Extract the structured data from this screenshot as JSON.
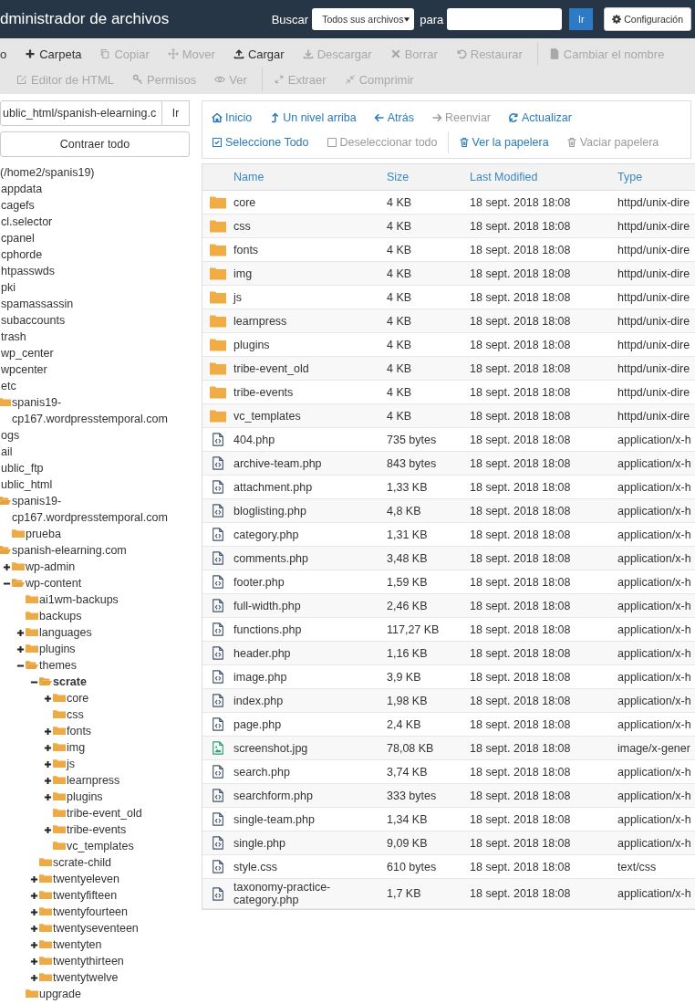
{
  "header": {
    "title": "dministrador de archivos",
    "search_label": "Buscar",
    "search_scope": "Todos sus archivos",
    "for_label": "para",
    "go_button": "Ir",
    "settings_button": "Configuración"
  },
  "toolbar": {
    "lines": [
      {
        "groups": [
          {
            "buttons": [
              {
                "label": "o",
                "disabled": false
              },
              {
                "label": "Carpeta",
                "disabled": false
              },
              {
                "label": "Copiar",
                "disabled": true
              },
              {
                "label": "Mover",
                "disabled": true
              },
              {
                "label": "Cargar",
                "disabled": false
              },
              {
                "label": "Descargar",
                "disabled": true
              },
              {
                "label": "Borrar",
                "disabled": true
              },
              {
                "label": "Restaurar",
                "disabled": true
              }
            ]
          },
          {
            "buttons": [
              {
                "label": "Cambiar el nombre",
                "disabled": true
              }
            ]
          }
        ]
      },
      {
        "groups": [
          {
            "buttons": [
              {
                "label": "Editor de HTML",
                "disabled": true
              },
              {
                "label": "Permisos",
                "disabled": true
              },
              {
                "label": "Ver",
                "disabled": true
              }
            ]
          },
          {
            "buttons": [
              {
                "label": "Extraer",
                "disabled": true
              },
              {
                "label": "Comprimir",
                "disabled": true
              }
            ]
          }
        ]
      }
    ]
  },
  "sidebar": {
    "path": "ublic_html/spanish-elearning.c",
    "path_button": "Ir",
    "collapse_button": "Contraer todo",
    "root": "(/home2/spanis19)",
    "tree": [
      {
        "label": "appdata",
        "selected": false
      },
      {
        "label": "cagefs",
        "selected": false
      },
      {
        "label": "cl.selector",
        "selected": false
      },
      {
        "label": "cpanel",
        "selected": false
      },
      {
        "label": "cphorde",
        "selected": false
      },
      {
        "label": "htpasswds",
        "selected": false
      },
      {
        "label": "pki",
        "selected": false
      },
      {
        "label": "spamassassin",
        "selected": false
      },
      {
        "label": "subaccounts",
        "selected": false
      },
      {
        "label": "trash",
        "selected": false
      },
      {
        "label": "wp_center",
        "selected": false
      },
      {
        "label": "wpcenter",
        "selected": false
      },
      {
        "label": "etc",
        "selected": false,
        "children": [
          {
            "label": "spanis19-cp167.wordpresstemporal.com",
            "selected": false
          }
        ]
      },
      {
        "label": "ogs",
        "selected": false
      },
      {
        "label": "ail",
        "selected": false
      },
      {
        "label": "ublic_ftp",
        "selected": false
      },
      {
        "label": "ublic_html",
        "selected": false,
        "children": [
          {
            "label": "spanis19-cp167.wordpresstemporal.com",
            "selected": false,
            "expanded": true,
            "children": [
              {
                "label": "prueba",
                "selected": false
              }
            ]
          },
          {
            "label": "spanish-elearning.com",
            "selected": false,
            "expanded": true,
            "children": [
              {
                "label": "wp-admin",
                "selected": false,
                "expanded": false
              },
              {
                "label": "wp-content",
                "selected": false,
                "expanded": true,
                "children": [
                  {
                    "label": "ai1wm-backups",
                    "selected": false
                  },
                  {
                    "label": "backups",
                    "selected": false
                  },
                  {
                    "label": "languages",
                    "selected": false,
                    "expanded": false
                  },
                  {
                    "label": "plugins",
                    "selected": false,
                    "expanded": false
                  },
                  {
                    "label": "themes",
                    "selected": false,
                    "expanded": true,
                    "children": [
                      {
                        "label": "scrate",
                        "selected": true,
                        "expanded": true,
                        "children": [
                          {
                            "label": "core",
                            "selected": false,
                            "expanded": false
                          },
                          {
                            "label": "css",
                            "selected": false
                          },
                          {
                            "label": "fonts",
                            "selected": false,
                            "expanded": false
                          },
                          {
                            "label": "img",
                            "selected": false,
                            "expanded": false
                          },
                          {
                            "label": "js",
                            "selected": false,
                            "expanded": false
                          },
                          {
                            "label": "learnpress",
                            "selected": false,
                            "expanded": false
                          },
                          {
                            "label": "plugins",
                            "selected": false,
                            "expanded": false
                          },
                          {
                            "label": "tribe-event_old",
                            "selected": false
                          },
                          {
                            "label": "tribe-events",
                            "selected": false,
                            "expanded": false
                          },
                          {
                            "label": "vc_templates",
                            "selected": false
                          }
                        ]
                      },
                      {
                        "label": "scrate-child",
                        "selected": false
                      },
                      {
                        "label": "twentyeleven",
                        "selected": false,
                        "expanded": false
                      },
                      {
                        "label": "twentyfifteen",
                        "selected": false,
                        "expanded": false
                      },
                      {
                        "label": "twentyfourteen",
                        "selected": false,
                        "expanded": false
                      },
                      {
                        "label": "twentyseventeen",
                        "selected": false,
                        "expanded": false
                      },
                      {
                        "label": "twentyten",
                        "selected": false,
                        "expanded": false
                      },
                      {
                        "label": "twentythirteen",
                        "selected": false,
                        "expanded": false
                      },
                      {
                        "label": "twentytwelve",
                        "selected": false,
                        "expanded": false
                      }
                    ]
                  },
                  {
                    "label": "upgrade",
                    "selected": false
                  }
                ]
              }
            ]
          }
        ]
      }
    ]
  },
  "nav": {
    "lines": [
      {
        "buttons": [
          {
            "label": "Inicio",
            "disabled": false
          },
          {
            "label": "Un nivel arriba",
            "disabled": false
          },
          {
            "label": "Atrás",
            "disabled": false
          },
          {
            "label": "Reenviar",
            "disabled": true
          },
          {
            "label": "Actualizar",
            "disabled": false
          }
        ]
      },
      {
        "buttons": [
          {
            "label": "Seleccione Todo",
            "disabled": false
          },
          {
            "label": "Deseleccionar todo",
            "disabled": true
          },
          {
            "label": "Ver la papelera",
            "disabled": false
          },
          {
            "label": "Vaciar papelera",
            "disabled": true
          }
        ]
      }
    ]
  },
  "table": {
    "columns": [
      "Name",
      "Size",
      "Last Modified",
      "Type"
    ],
    "rows": [
      {
        "kind": "folder",
        "name": "core",
        "size": "4 KB",
        "modified": "18 sept. 2018 18:08",
        "type": "httpd/unix-dire"
      },
      {
        "kind": "folder",
        "name": "css",
        "size": "4 KB",
        "modified": "18 sept. 2018 18:08",
        "type": "httpd/unix-dire"
      },
      {
        "kind": "folder",
        "name": "fonts",
        "size": "4 KB",
        "modified": "18 sept. 2018 18:08",
        "type": "httpd/unix-dire"
      },
      {
        "kind": "folder",
        "name": "img",
        "size": "4 KB",
        "modified": "18 sept. 2018 18:08",
        "type": "httpd/unix-dire"
      },
      {
        "kind": "folder",
        "name": "js",
        "size": "4 KB",
        "modified": "18 sept. 2018 18:08",
        "type": "httpd/unix-dire"
      },
      {
        "kind": "folder",
        "name": "learnpress",
        "size": "4 KB",
        "modified": "18 sept. 2018 18:08",
        "type": "httpd/unix-dire"
      },
      {
        "kind": "folder",
        "name": "plugins",
        "size": "4 KB",
        "modified": "18 sept. 2018 18:08",
        "type": "httpd/unix-dire"
      },
      {
        "kind": "folder",
        "name": "tribe-event_old",
        "size": "4 KB",
        "modified": "18 sept. 2018 18:08",
        "type": "httpd/unix-dire"
      },
      {
        "kind": "folder",
        "name": "tribe-events",
        "size": "4 KB",
        "modified": "18 sept. 2018 18:08",
        "type": "httpd/unix-dire"
      },
      {
        "kind": "folder",
        "name": "vc_templates",
        "size": "4 KB",
        "modified": "18 sept. 2018 18:08",
        "type": "httpd/unix-dire"
      },
      {
        "kind": "code",
        "name": "404.php",
        "size": "735 bytes",
        "modified": "18 sept. 2018 18:08",
        "type": "application/x-h"
      },
      {
        "kind": "code",
        "name": "archive-team.php",
        "size": "843 bytes",
        "modified": "18 sept. 2018 18:08",
        "type": "application/x-h"
      },
      {
        "kind": "code",
        "name": "attachment.php",
        "size": "1,33 KB",
        "modified": "18 sept. 2018 18:08",
        "type": "application/x-h"
      },
      {
        "kind": "code",
        "name": "bloglisting.php",
        "size": "4,8 KB",
        "modified": "18 sept. 2018 18:08",
        "type": "application/x-h"
      },
      {
        "kind": "code",
        "name": "category.php",
        "size": "1,31 KB",
        "modified": "18 sept. 2018 18:08",
        "type": "application/x-h"
      },
      {
        "kind": "code",
        "name": "comments.php",
        "size": "3,48 KB",
        "modified": "18 sept. 2018 18:08",
        "type": "application/x-h"
      },
      {
        "kind": "code",
        "name": "footer.php",
        "size": "1,59 KB",
        "modified": "18 sept. 2018 18:08",
        "type": "application/x-h"
      },
      {
        "kind": "code",
        "name": "full-width.php",
        "size": "2,46 KB",
        "modified": "18 sept. 2018 18:08",
        "type": "application/x-h"
      },
      {
        "kind": "code",
        "name": "functions.php",
        "size": "117,27 KB",
        "modified": "18 sept. 2018 18:08",
        "type": "application/x-h"
      },
      {
        "kind": "code",
        "name": "header.php",
        "size": "1,16 KB",
        "modified": "18 sept. 2018 18:08",
        "type": "application/x-h"
      },
      {
        "kind": "code",
        "name": "image.php",
        "size": "3,9 KB",
        "modified": "18 sept. 2018 18:08",
        "type": "application/x-h"
      },
      {
        "kind": "code",
        "name": "index.php",
        "size": "1,98 KB",
        "modified": "18 sept. 2018 18:08",
        "type": "application/x-h"
      },
      {
        "kind": "code",
        "name": "page.php",
        "size": "2,4 KB",
        "modified": "18 sept. 2018 18:08",
        "type": "application/x-h"
      },
      {
        "kind": "image",
        "name": "screenshot.jpg",
        "size": "78,08 KB",
        "modified": "18 sept. 2018 18:08",
        "type": "image/x-gener"
      },
      {
        "kind": "code",
        "name": "search.php",
        "size": "3,74 KB",
        "modified": "18 sept. 2018 18:08",
        "type": "application/x-h"
      },
      {
        "kind": "code",
        "name": "searchform.php",
        "size": "333 bytes",
        "modified": "18 sept. 2018 18:08",
        "type": "application/x-h"
      },
      {
        "kind": "code",
        "name": "single-team.php",
        "size": "1,34 KB",
        "modified": "18 sept. 2018 18:08",
        "type": "application/x-h"
      },
      {
        "kind": "code",
        "name": "single.php",
        "size": "9,09 KB",
        "modified": "18 sept. 2018 18:08",
        "type": "application/x-h"
      },
      {
        "kind": "code",
        "name": "style.css",
        "size": "610 bytes",
        "modified": "18 sept. 2018 18:08",
        "type": "text/css"
      },
      {
        "kind": "code",
        "name": "taxonomy-practice-category.php",
        "size": "1,7 KB",
        "modified": "18 sept. 2018 18:08",
        "type": "application/x-h"
      }
    ]
  }
}
